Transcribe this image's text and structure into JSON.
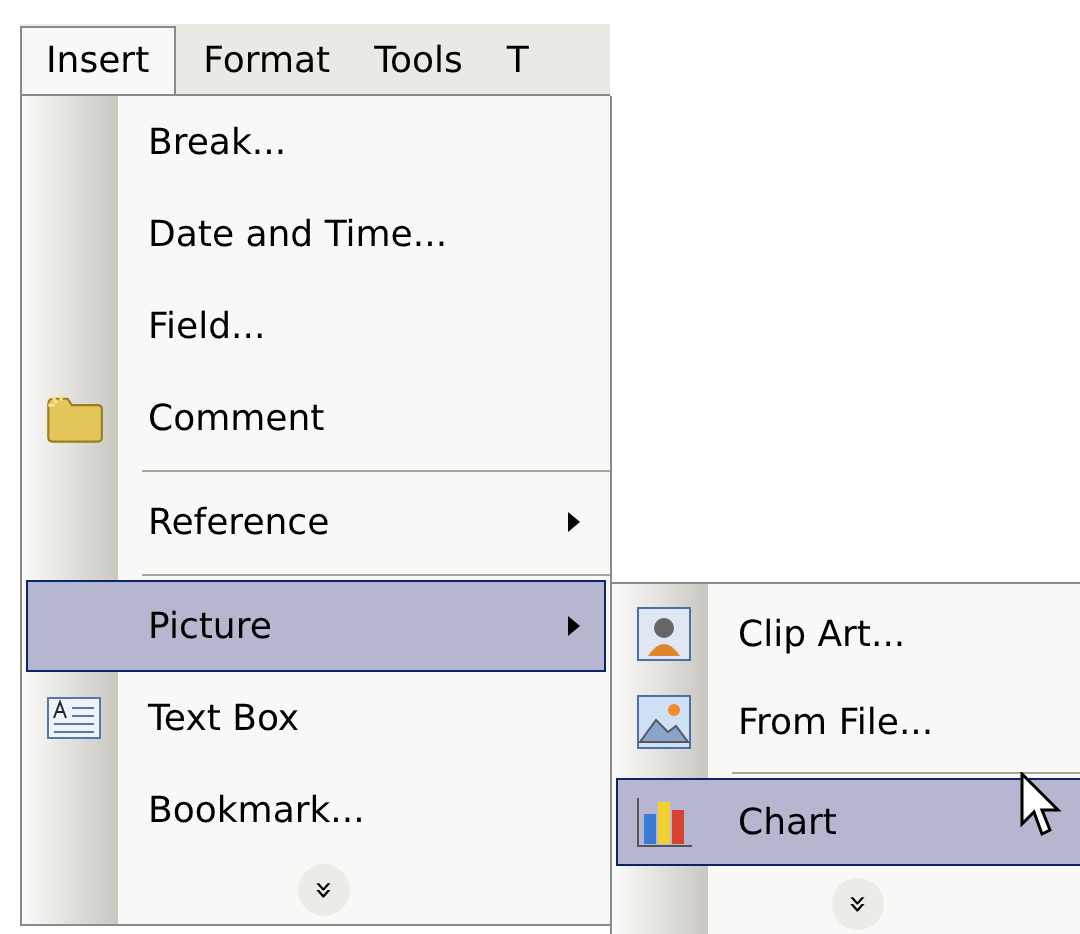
{
  "menu_bar": [
    {
      "label": "Insert",
      "selected": true
    },
    {
      "label": "Format",
      "selected": false
    },
    {
      "label": "Tools",
      "selected": false
    },
    {
      "label": "T",
      "selected": false
    }
  ],
  "insert_menu": [
    {
      "kind": "item",
      "label": "Break...",
      "has_submenu": false,
      "selected": false
    },
    {
      "kind": "item",
      "label": "Date and Time...",
      "has_submenu": false,
      "selected": false
    },
    {
      "kind": "item",
      "label": "Field...",
      "has_submenu": false,
      "selected": false
    },
    {
      "kind": "item",
      "label": "Comment",
      "has_submenu": false,
      "selected": false
    },
    {
      "kind": "separator"
    },
    {
      "kind": "item",
      "label": "Reference",
      "has_submenu": true,
      "selected": false
    },
    {
      "kind": "separator"
    },
    {
      "kind": "item",
      "label": "Picture",
      "has_submenu": true,
      "selected": true
    },
    {
      "kind": "item",
      "label": "Text Box",
      "has_submenu": false,
      "selected": false
    },
    {
      "kind": "item",
      "label": "Bookmark...",
      "has_submenu": false,
      "selected": false
    },
    {
      "kind": "expand",
      "label": "»"
    }
  ],
  "picture_submenu": [
    {
      "kind": "item",
      "label": "Clip Art...",
      "has_submenu": false,
      "selected": false
    },
    {
      "kind": "item",
      "label": "From File...",
      "has_submenu": false,
      "selected": false
    },
    {
      "kind": "separator"
    },
    {
      "kind": "item",
      "label": "Chart",
      "has_submenu": false,
      "selected": true
    },
    {
      "kind": "expand",
      "label": "»"
    }
  ]
}
